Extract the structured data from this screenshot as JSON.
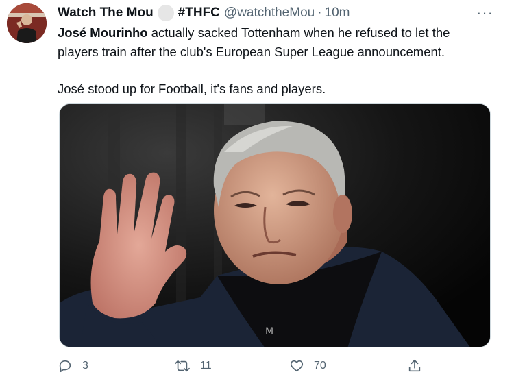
{
  "tweet": {
    "display_name": "Watch The Mou",
    "name_tag": "#THFC",
    "handle": "@watchtheMou",
    "separator": "·",
    "time": "10m",
    "more_label": "···",
    "text": {
      "line1_bold": "José Mourinho",
      "line1_rest": " actually sacked Tottenham when he refused to let the",
      "line2": "players train after the club's European Super League announcement.",
      "line3": "José stood up for Football, it's fans and players."
    },
    "media": {
      "description": "photo"
    },
    "actions": {
      "reply_count": "3",
      "retweet_count": "11",
      "like_count": "70"
    }
  },
  "icons": {
    "reply": "reply-icon",
    "retweet": "retweet-icon",
    "like": "heart-icon",
    "share": "share-icon",
    "more": "more-icon"
  },
  "colors": {
    "text_primary": "#0f1419",
    "text_secondary": "#536471",
    "border": "#cfd9de"
  }
}
